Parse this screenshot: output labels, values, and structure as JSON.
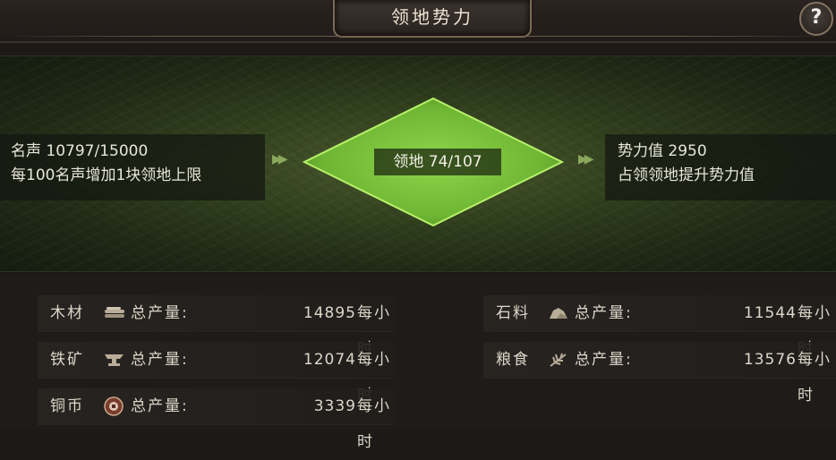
{
  "header": {
    "title": "领地势力",
    "help_label": "?"
  },
  "banner": {
    "fame": {
      "line1": "名声 10797/15000",
      "line2": "每100名声增加1块领地上限"
    },
    "territory": {
      "label": "领地 74/107"
    },
    "power": {
      "line1": "势力值 2950",
      "line2": "占领领地提升势力值"
    },
    "diamond_color": "#8fd44a"
  },
  "production": {
    "per_label": "总产量:",
    "unit": "每小时",
    "left": [
      {
        "name": "木材",
        "icon": "wood-icon",
        "value": "14895"
      },
      {
        "name": "铁矿",
        "icon": "iron-anvil-icon",
        "value": "12074"
      },
      {
        "name": "铜币",
        "icon": "copper-coin-icon",
        "value": "3339"
      }
    ],
    "right": [
      {
        "name": "石料",
        "icon": "stone-icon",
        "value": "11544"
      },
      {
        "name": "粮食",
        "icon": "grain-icon",
        "value": "13576"
      }
    ]
  }
}
